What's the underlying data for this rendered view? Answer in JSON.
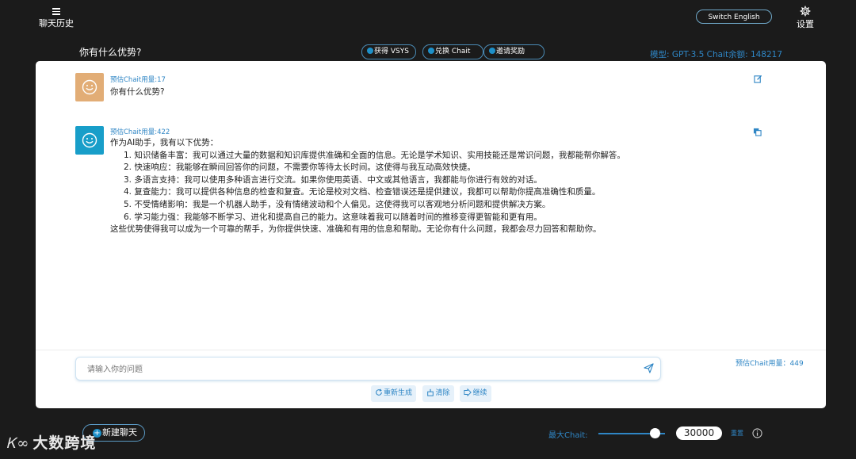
{
  "header": {
    "history_label": "聊天历史",
    "switch_language_label": "Switch English",
    "settings_label": "设置",
    "page_title": "你有什么优势?",
    "pills": [
      {
        "label": "获得 VSYS"
      },
      {
        "label": "兑换 Chait"
      },
      {
        "label": "邀请奖励"
      }
    ],
    "model_info": "模型: GPT-3.5 Chait余额: 148217"
  },
  "conversation": {
    "user_message": {
      "usage": "预估Chait用量:17",
      "text": "你有什么优势?"
    },
    "bot_message": {
      "usage": "预估Chait用量:422",
      "intro": "作为AI助手，我有以下优势：",
      "items": [
        "1. 知识储备丰富：我可以通过大量的数据和知识库提供准确和全面的信息。无论是学术知识、实用技能还是常识问题，我都能帮你解答。",
        "2. 快速响应：我能够在瞬间回答你的问题，不需要你等待太长时间。这使得与我互动高效快捷。",
        "3. 多语言支持：我可以使用多种语言进行交流。如果你使用英语、中文或其他语言，我都能与你进行有效的对话。",
        "4. 复查能力：我可以提供各种信息的检查和复查。无论是校对文档、检查错误还是提供建议，我都可以帮助你提高准确性和质量。",
        "5. 不受情绪影响：我是一个机器人助手，没有情绪波动和个人偏见。这使得我可以客观地分析问题和提供解决方案。",
        "6. 学习能力强：我能够不断学习、进化和提高自己的能力。这意味着我可以随着时间的推移变得更智能和更有用。"
      ],
      "conclusion": "这些优势使得我可以成为一个可靠的帮手，为你提供快速、准确和有用的信息和帮助。无论你有什么问题，我都会尽力回答和帮助你。"
    }
  },
  "composer": {
    "placeholder": "请输入你的问题",
    "estimated_usage": "预估Chait用量：449",
    "regenerate_label": "重新生成",
    "clear_label": "清除",
    "continue_label": "继续"
  },
  "footer": {
    "new_chat_label": "新建聊天",
    "watermark_logo": "Ꮶ∞",
    "watermark_text": "大数跨境",
    "max_chait_label": "最大Chait:",
    "max_chait_value": "30000",
    "reset_label": "重置",
    "max_chait_fraction": 0.85
  },
  "colors": {
    "background": "#1b1b1b",
    "accent": "#2f86c5",
    "user_avatar": "#e2ad76",
    "bot_avatar": "#189ec9"
  }
}
